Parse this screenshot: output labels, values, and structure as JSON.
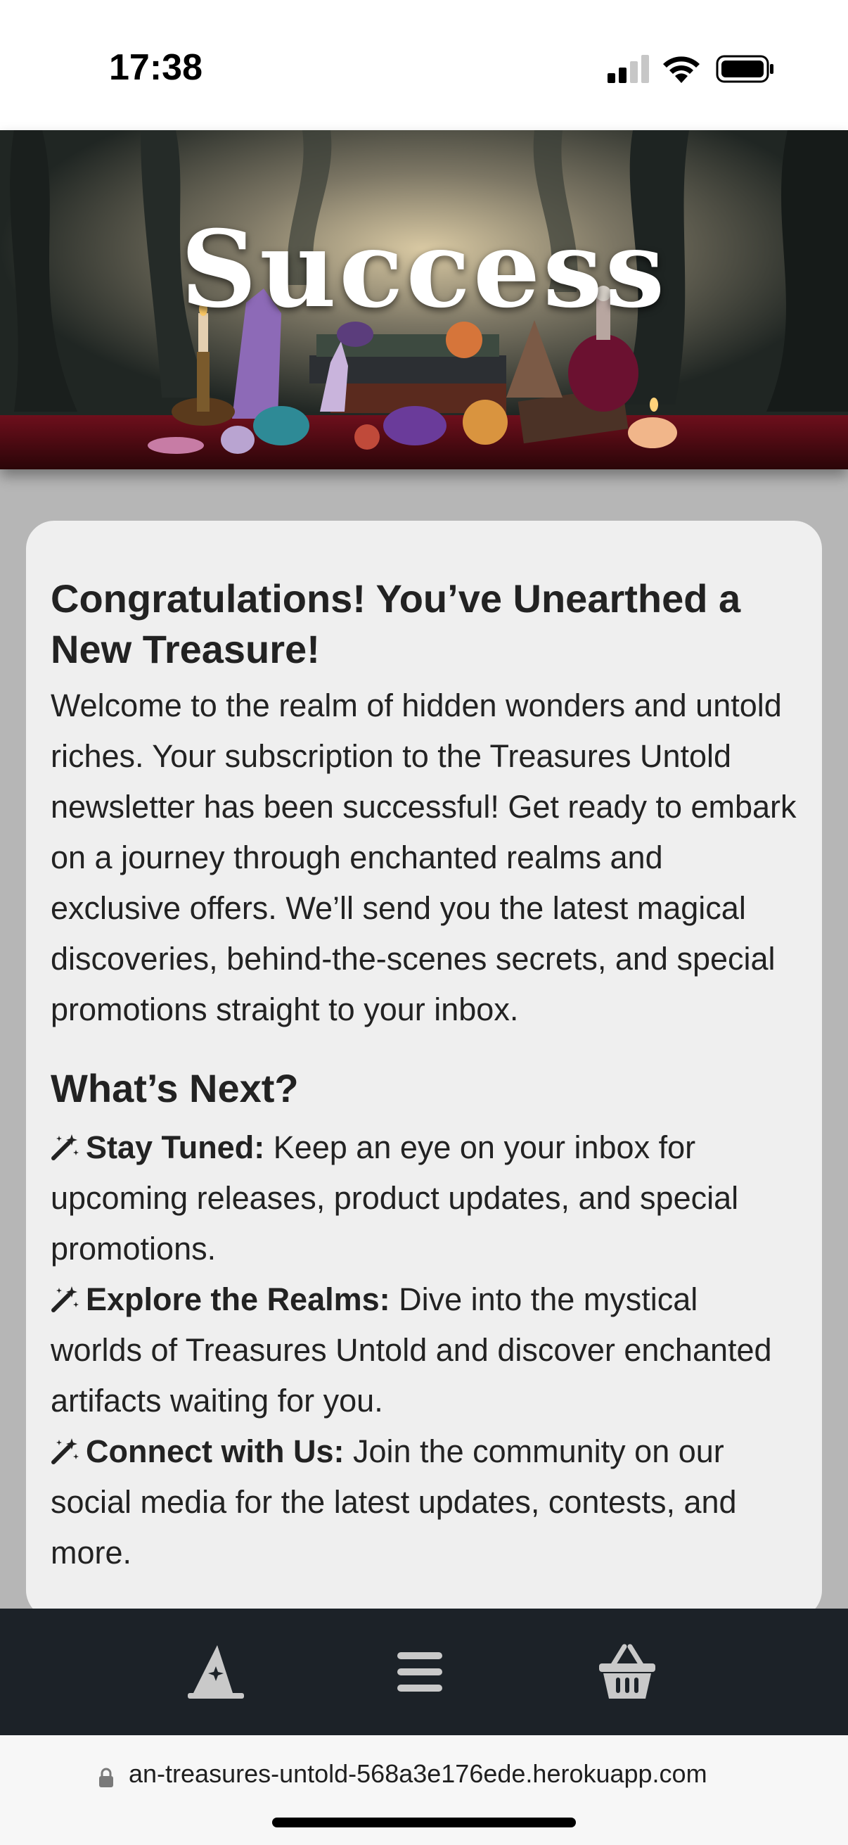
{
  "status_bar": {
    "time": "17:38",
    "icons": [
      "signal-icon",
      "wifi-icon",
      "battery-icon"
    ]
  },
  "hero": {
    "title": "Success"
  },
  "card": {
    "heading": "Congratulations! You’ve Unearthed a New Treasure!",
    "welcome_text": "Welcome to the realm of hidden wonders and untold riches. Your subscription to the Treasures Untold newsletter has been successful! Get ready to embark on a journey through enchanted realms and exclusive offers. We’ll send you the latest magical discoveries, behind-the-scenes secrets, and special promotions straight to your inbox.",
    "next_heading": "What’s Next?",
    "items": [
      {
        "title": "Stay Tuned:",
        "text": " Keep an eye on your inbox for upcoming releases, product updates, and special promotions."
      },
      {
        "title": "Explore the Realms:",
        "text": " Dive into the mystical worlds of Treasures Untold and discover enchanted artifacts waiting for you."
      },
      {
        "title": "Connect with Us:",
        "text": " Join the community on our social media for the latest updates, contests, and more."
      }
    ]
  },
  "bottom_nav": {
    "items": [
      "wizard-hat-icon",
      "menu-icon",
      "basket-icon"
    ]
  },
  "url_bar": {
    "url": "an-treasures-untold-568a3e176ede.herokuapp.com"
  },
  "colors": {
    "nav_background": "#1c2228",
    "card_background": "#efefef",
    "page_background": "#b6b6b6"
  }
}
